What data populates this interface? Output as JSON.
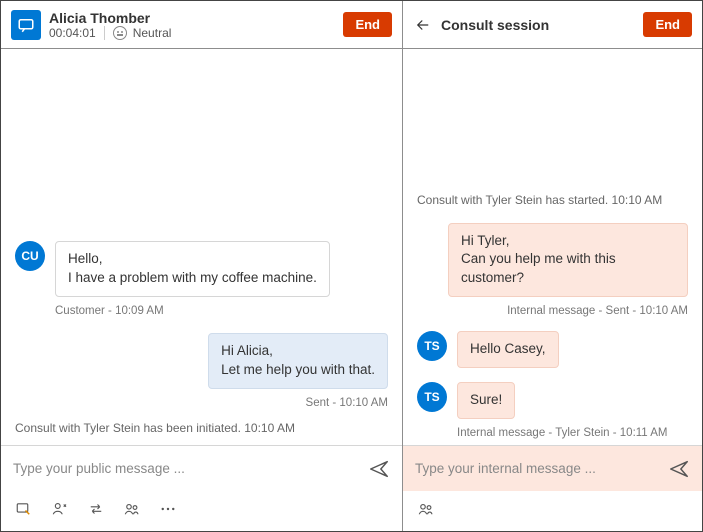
{
  "left": {
    "customer_name": "Alicia Thomber",
    "timer": "00:04:01",
    "sentiment": "Neutral",
    "end_label": "End",
    "messages": {
      "cust1": "Hello,\nI have a problem with my coffee machine.",
      "cust1_meta": "Customer - 10:09 AM",
      "agent1": "Hi Alicia,\nLet me help you with that.",
      "agent1_meta": "Sent - 10:10 AM",
      "sys1": "Consult with Tyler Stein has been initiated. 10:10 AM"
    },
    "input_placeholder": "Type your public message ...",
    "avatars": {
      "cust": "CU"
    }
  },
  "right": {
    "title": "Consult session",
    "end_label": "End",
    "sys1": "Consult with Tyler Stein has started. 10:10 AM",
    "out1": "Hi Tyler,\nCan you help me with this customer?",
    "out1_meta": "Internal message - Sent - 10:10 AM",
    "in1": "Hello Casey,",
    "in2": "Sure!",
    "in_meta": "Internal message - Tyler Stein - 10:11 AM",
    "input_placeholder": "Type your internal message ...",
    "avatars": {
      "ts": "TS"
    }
  }
}
